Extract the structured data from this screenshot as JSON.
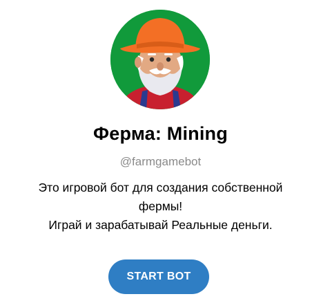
{
  "bot": {
    "name": "Ферма: Mining",
    "username": "@farmgamebot",
    "description_lines": [
      "Это игровой бот для создания собственной",
      "фермы!",
      "Играй и зарабатывай Реальные деньги."
    ]
  },
  "actions": {
    "start_label": "START BOT"
  },
  "avatar": {
    "icon": "farmer-avatar-icon",
    "background_color": "#119a3b",
    "hat_color": "#f36f25",
    "shirt_color": "#c8202f"
  },
  "colors": {
    "button": "#2f7ec4",
    "username": "#8a8a8a"
  }
}
